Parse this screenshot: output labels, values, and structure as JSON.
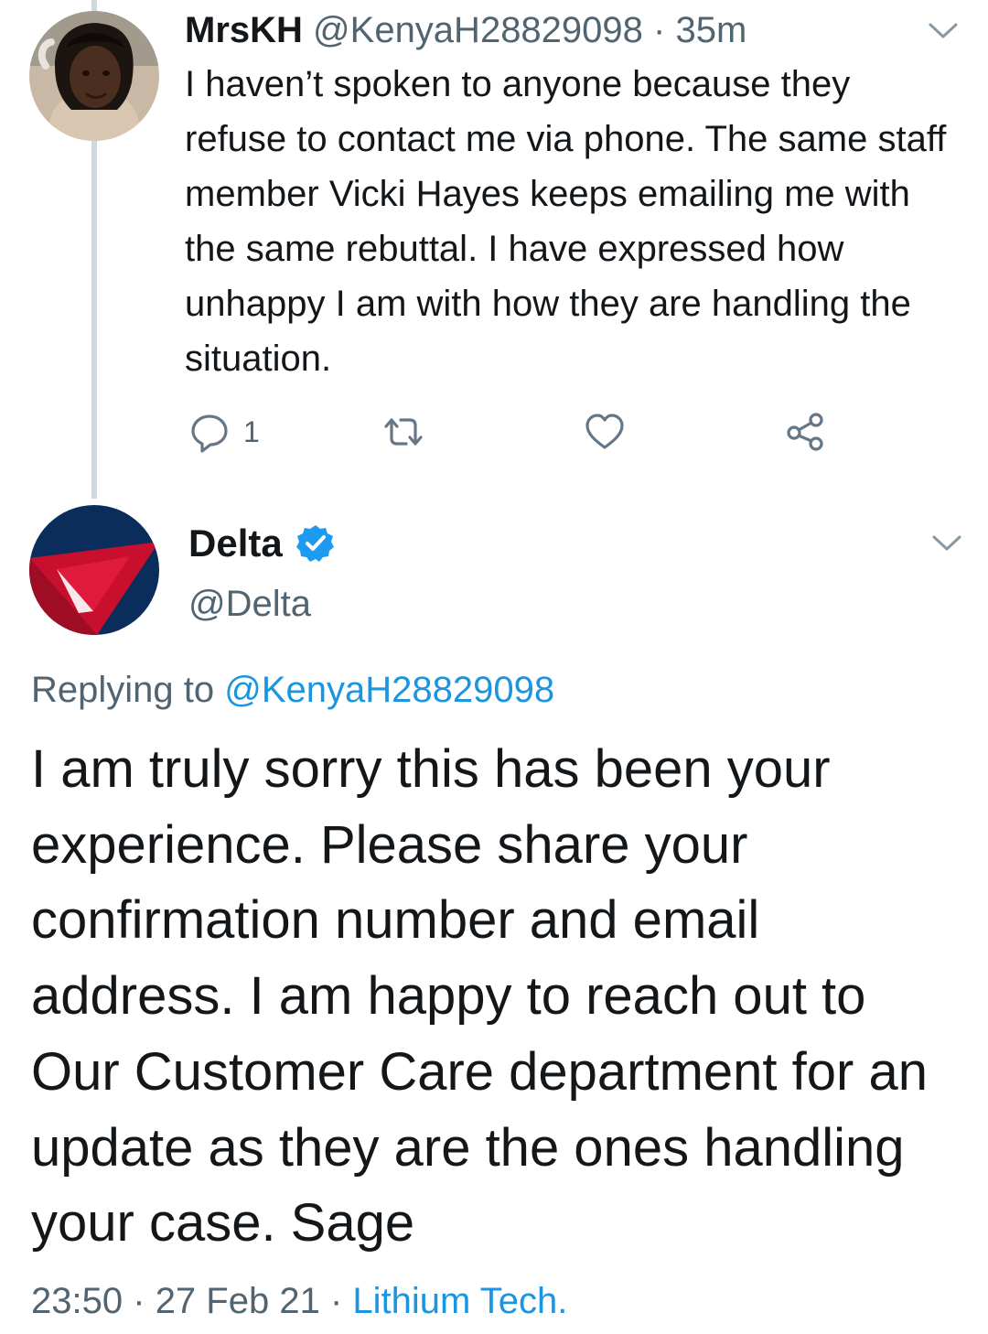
{
  "reply_tweet": {
    "display_name": "MrsKH",
    "handle": "@KenyaH28829098",
    "separator": "·",
    "time": "35m",
    "text": "I haven’t spoken to anyone because they refuse to contact me via phone. The same staff member Vicki Hayes keeps emailing me with the same rebuttal. I have expressed how unhappy I am with how they are handling the situation.",
    "reply_count": "1",
    "icons": [
      "reply-icon",
      "retweet-icon",
      "like-icon",
      "share-icon",
      "chevron-down-icon"
    ]
  },
  "main_tweet": {
    "display_name": "Delta",
    "verified": true,
    "handle": "@Delta",
    "replying_prefix": "Replying to",
    "replying_to": "@KenyaH28829098",
    "text": "I am truly sorry this has been your experience. Please share your confirmation number and email address. I am happy to reach out to Our Customer Care department for an update as they are the ones handling your case. Sage",
    "time": "23:50",
    "separator": "·",
    "date": "27 Feb 21",
    "source": "Lithium Tech."
  },
  "colors": {
    "link_blue": "#1b95e0",
    "muted_text": "#536471",
    "thread_line": "#cfd9de",
    "delta_red": "#c8102e",
    "delta_navy": "#0b2d5c"
  }
}
